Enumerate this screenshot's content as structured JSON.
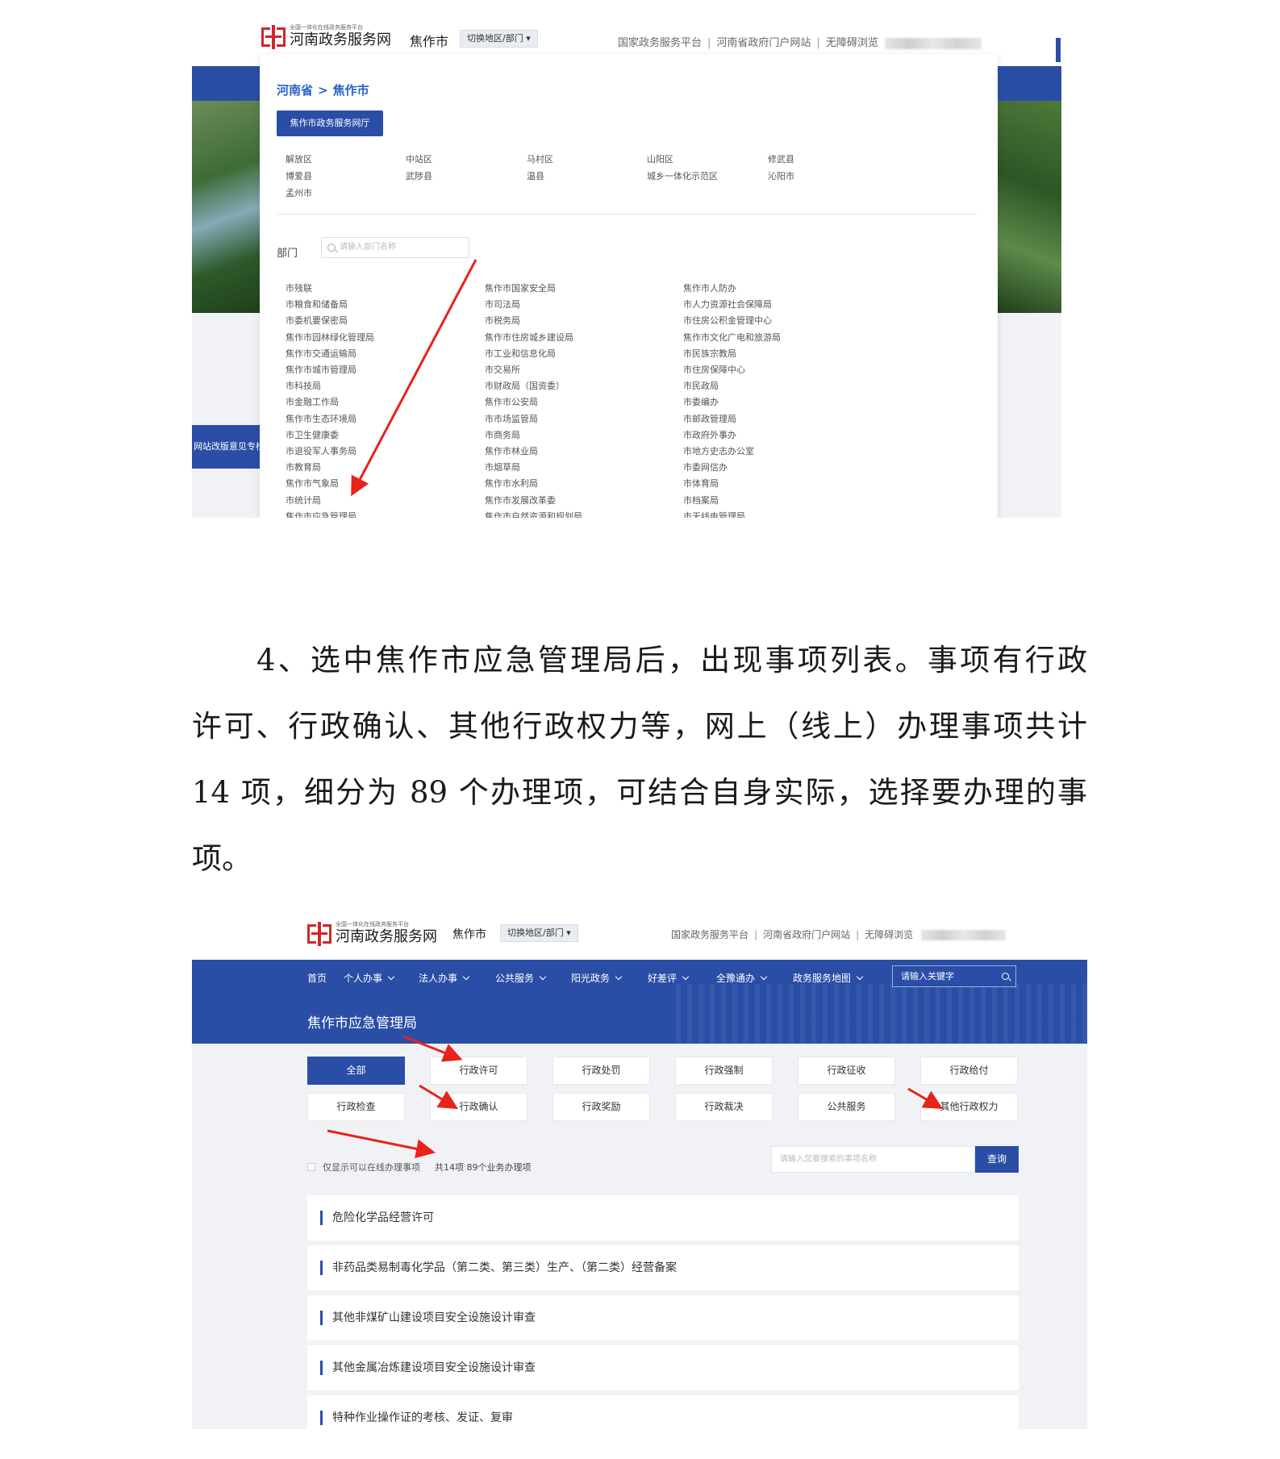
{
  "shot1": {
    "logo": {
      "small": "全国一体化在线政务服务平台",
      "big": "河南政务服务网"
    },
    "city": "焦作市",
    "switch_label": "切换地区/部门",
    "top_links": [
      "国家政务服务平台",
      "河南省政府门户网站",
      "无障碍浏览"
    ],
    "side_tag": "网站改版意见专栏",
    "breadcrumb": {
      "province": "河南省",
      "arrow": ">",
      "city": "焦作市"
    },
    "hall_button": "焦作市政务服务网厅",
    "districts": [
      "解放区",
      "中站区",
      "马村区",
      "山阳区",
      "修武县",
      "博爱县",
      "武陟县",
      "温县",
      "城乡一体化示范区",
      "沁阳市",
      "孟州市"
    ],
    "dept_label": "部门",
    "dept_search_placeholder": "请输入部门名称",
    "departments": {
      "col1": [
        "市残联",
        "市粮食和储备局",
        "市委机要保密局",
        "焦作市园林绿化管理局",
        "焦作市交通运输局",
        "焦作市城市管理局",
        "市科技局",
        "市金融工作局",
        "焦作市生态环境局",
        "市卫生健康委",
        "市退役军人事务局",
        "市教育局",
        "焦作市气象局",
        "市统计局",
        "焦作市应急管理局"
      ],
      "col2": [
        "焦作市国家安全局",
        "市司法局",
        "市税务局",
        "焦作市住房城乡建设局",
        "市工业和信息化局",
        "市交易所",
        "市财政局（国资委）",
        "焦作市公安局",
        "市市场监管局",
        "市商务局",
        "焦作市林业局",
        "市烟草局",
        "焦作市水利局",
        "焦作市发展改革委",
        "焦作市自然资源和规划局"
      ],
      "col3": [
        "焦作市人防办",
        "市人力资源社会保障局",
        "市住房公积金管理中心",
        "焦作市文化广电和旅游局",
        "市民族宗教局",
        "市住房保障中心",
        "市民政局",
        "市委编办",
        "市邮政管理局",
        "市政府外事办",
        "市地方史志办公室",
        "市委网信办",
        "市体育局",
        "市档案局",
        "市无线电管理局"
      ]
    }
  },
  "paragraph": {
    "lines": [
      "4、选中焦作市应急管理局后，出现事项列表。事项有行政",
      "许可、行政确认、其他行政权力等，网上（线上）办理事项共计",
      "14 项，细分为 89 个办理项，可结合自身实际，选择要办理的事",
      "项。"
    ]
  },
  "shot2": {
    "logo": {
      "small": "全国一体化在线政务服务平台",
      "big": "河南政务服务网"
    },
    "city": "焦作市",
    "switch_label": "切换地区/部门",
    "top_links": [
      "国家政务服务平台",
      "河南省政府门户网站",
      "无障碍浏览"
    ],
    "nav": [
      "首页",
      "个人办事",
      "法人办事",
      "公共服务",
      "阳光政务",
      "好差评",
      "全豫通办",
      "政务服务地图"
    ],
    "nav_search_placeholder": "请输入关键字",
    "dept_title": "焦作市应急管理局",
    "tabs_row1": [
      "全部",
      "行政许可",
      "行政处罚",
      "行政强制",
      "行政征收",
      "行政给付"
    ],
    "tabs_row2": [
      "行政检查",
      "行政确认",
      "行政奖励",
      "行政裁决",
      "公共服务",
      "其他行政权力"
    ],
    "active_tab": "全部",
    "online_only_label": "仅显示可以在线办理事项",
    "count_text": "共14项 89个业务办理项",
    "item_search_placeholder": "请输入您要搜索的事项名称",
    "query_button": "查询",
    "items": [
      "危险化学品经营许可",
      "非药品类易制毒化学品（第二类、第三类）生产、（第二类）经营备案",
      "其他非煤矿山建设项目安全设施设计审查",
      "其他金属冶炼建设项目安全设施设计审查",
      "特种作业操作证的考核、发证、复审"
    ]
  },
  "colors": {
    "brand_blue": "#2a4ea6",
    "logo_red": "#d1252c",
    "annotation_red": "#e8231c",
    "link_blue": "#2a62c9"
  }
}
